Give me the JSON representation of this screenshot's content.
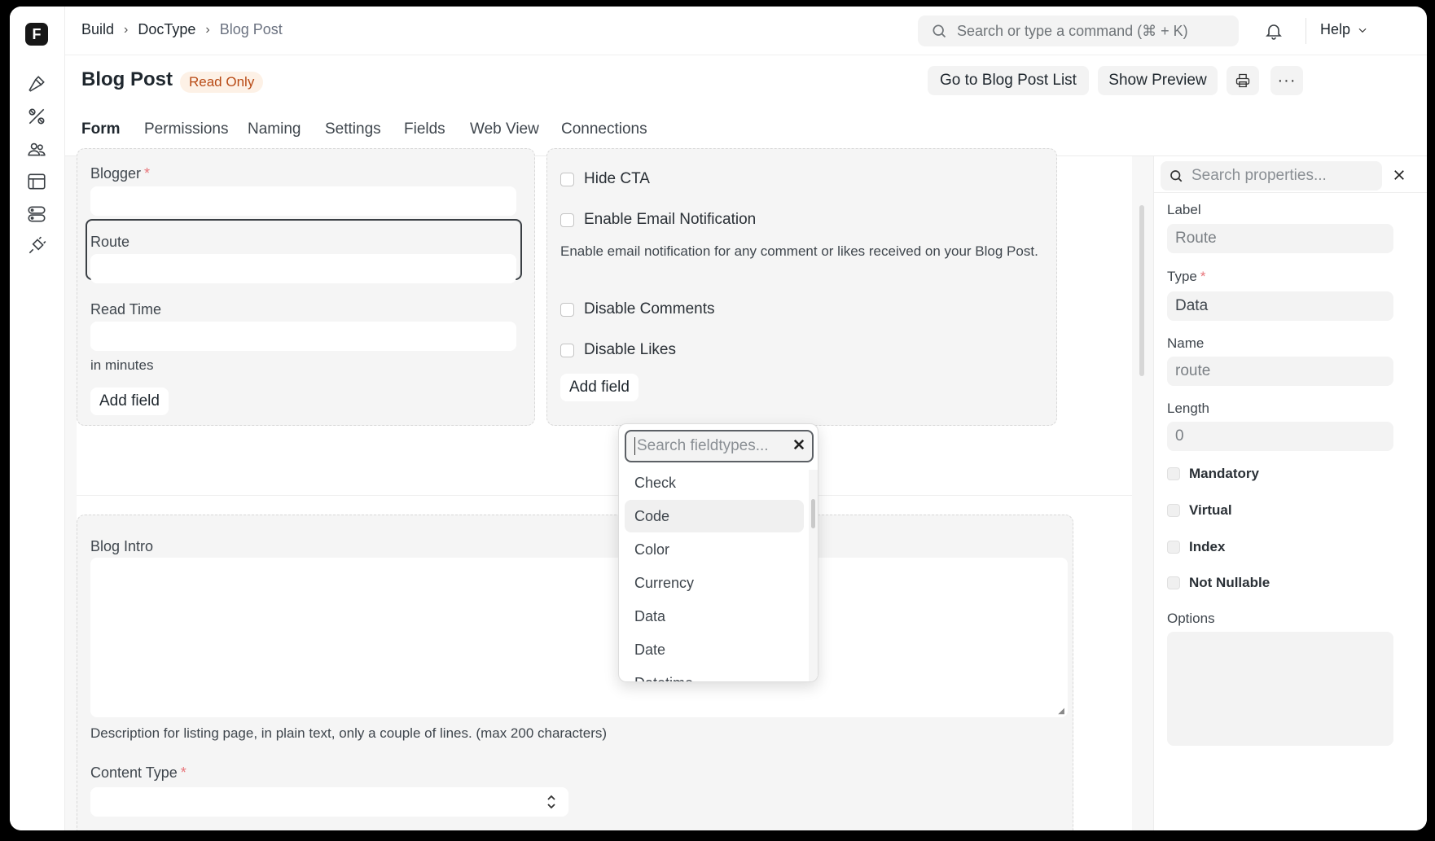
{
  "logo": "F",
  "breadcrumbs": [
    "Build",
    "DocType",
    "Blog Post"
  ],
  "search": {
    "placeholder": "Search or type a command (⌘ + K)"
  },
  "help_label": "Help",
  "page": {
    "title": "Blog Post",
    "badge": "Read Only"
  },
  "actions": {
    "list": "Go to Blog Post List",
    "preview": "Show Preview"
  },
  "tabs": [
    "Form",
    "Permissions",
    "Naming",
    "Settings",
    "Fields",
    "Web View",
    "Connections"
  ],
  "form": {
    "left": {
      "blogger_label": "Blogger",
      "route_label": "Route",
      "read_time_label": "Read Time",
      "read_time_hint": "in minutes",
      "add_field": "Add field"
    },
    "right": {
      "hide_cta": "Hide CTA",
      "enable_email": "Enable Email Notification",
      "email_hint": "Enable email notification for any comment or likes received on your Blog Post.",
      "disable_comments": "Disable Comments",
      "disable_likes": "Disable Likes",
      "add_field": "Add field"
    },
    "blog_intro_label": "Blog Intro",
    "blog_intro_hint": "Description for listing page, in plain text, only a couple of lines. (max 200 characters)",
    "content_type_label": "Content Type"
  },
  "fieldtype_dropdown": {
    "placeholder": "Search fieldtypes...",
    "items": [
      "Check",
      "Code",
      "Color",
      "Currency",
      "Data",
      "Date",
      "Datetime"
    ]
  },
  "properties": {
    "search_placeholder": "Search properties...",
    "label_label": "Label",
    "label_value": "Route",
    "type_label": "Type",
    "type_value": "Data",
    "name_label": "Name",
    "name_value": "route",
    "length_label": "Length",
    "length_value": "0",
    "checks": [
      "Mandatory",
      "Virtual",
      "Index",
      "Not Nullable"
    ],
    "options_label": "Options"
  }
}
